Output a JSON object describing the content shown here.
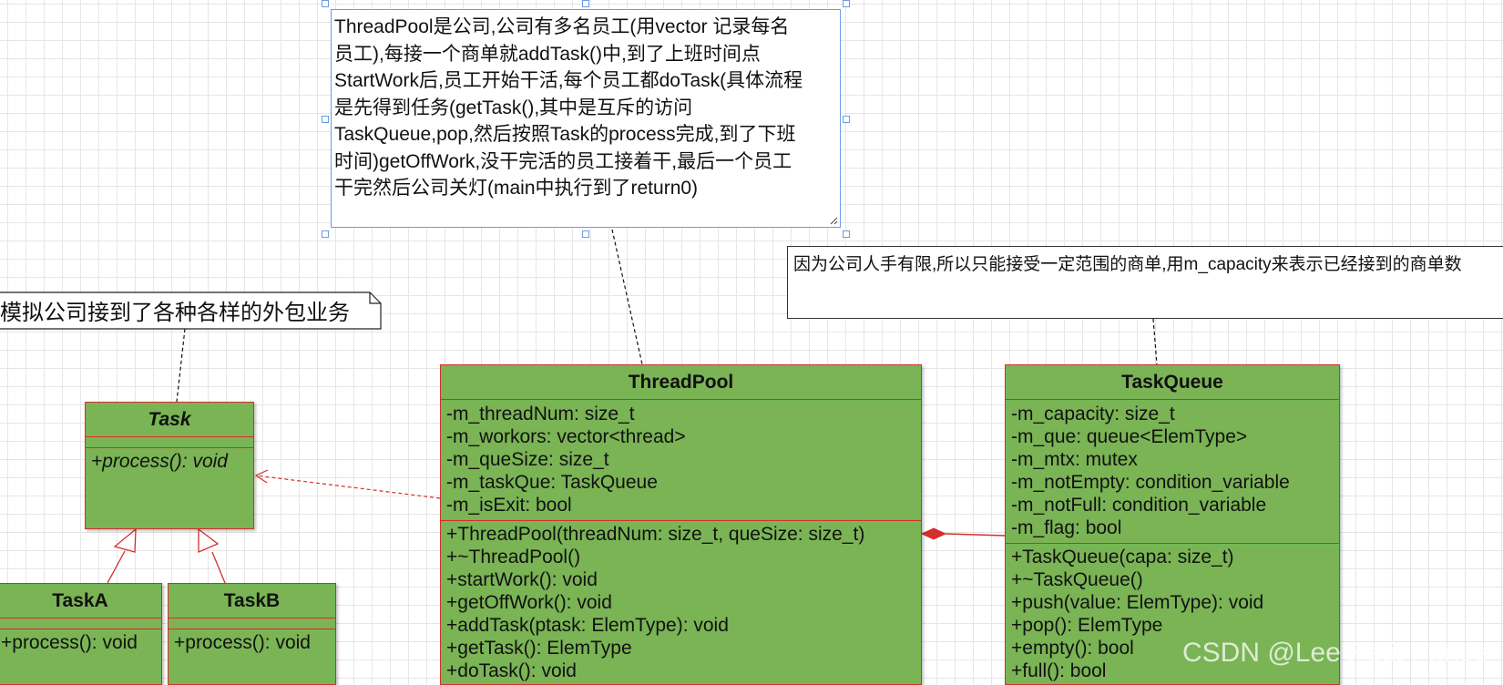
{
  "notes": {
    "threadpool_desc": "ThreadPool是公司,公司有多名员工(用vector 记录每名\n员工),每接一个商单就addTask()中,到了上班时间点\nStartWork后,员工开始干活,每个员工都doTask(具体流程\n是先得到任务(getTask(),其中是互斥的访问\nTaskQueue,pop,然后按照Task的process完成,到了下班\n时间)getOffWork,没干完活的员工接着干,最后一个员工\n干完然后公司关灯(main中执行到了return0)",
    "capacity_desc": "因为公司人手有限,所以只能接受一定范围的商单,用m_capacity来表示已经接到的商单数",
    "task_desc": "模拟公司接到了各种各样的外包业务"
  },
  "classes": {
    "task": {
      "name": "Task",
      "methods": [
        "+process(): void"
      ]
    },
    "taska": {
      "name": "TaskA",
      "methods": [
        "+process(): void"
      ]
    },
    "taskb": {
      "name": "TaskB",
      "methods": [
        "+process(): void"
      ]
    },
    "threadpool": {
      "name": "ThreadPool",
      "attributes": [
        "-m_threadNum: size_t",
        "-m_workors: vector<thread>",
        "-m_queSize: size_t",
        "-m_taskQue: TaskQueue",
        "-m_isExit: bool"
      ],
      "methods": [
        "+ThreadPool(threadNum: size_t, queSize: size_t)",
        "+~ThreadPool()",
        "+startWork(): void",
        "+getOffWork(): void",
        "+addTask(ptask: ElemType): void",
        "+getTask(): ElemType",
        "+doTask(): void"
      ]
    },
    "taskqueue": {
      "name": "TaskQueue",
      "attributes": [
        "-m_capacity: size_t",
        "-m_que: queue<ElemType>",
        "-m_mtx: mutex",
        "-m_notEmpty: condition_variable",
        "-m_notFull: condition_variable",
        "-m_flag: bool"
      ],
      "methods": [
        "+TaskQueue(capa: size_t)",
        "+~TaskQueue()",
        "+push(value: ElemType): void",
        "+pop(): ElemType",
        "+empty(): bool",
        "+full(): bool"
      ]
    }
  },
  "watermark": "CSDN @Lee Petit Prince",
  "colors": {
    "class_fill": "#7ab455",
    "class_border": "#d62d2d",
    "selection": "#6c9be4"
  }
}
